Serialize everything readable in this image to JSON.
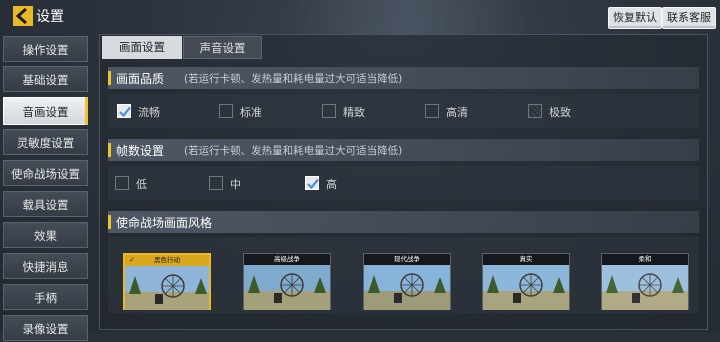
{
  "header": {
    "title": "设置",
    "reset_label": "恢复默认",
    "support_label": "联系客服"
  },
  "sidebar": {
    "items": [
      {
        "label": "操作设置"
      },
      {
        "label": "基础设置"
      },
      {
        "label": "音画设置",
        "active": true
      },
      {
        "label": "灵敏度设置"
      },
      {
        "label": "使命战场设置"
      },
      {
        "label": "载具设置"
      },
      {
        "label": "效果"
      },
      {
        "label": "快捷消息"
      },
      {
        "label": "手柄"
      },
      {
        "label": "录像设置"
      }
    ]
  },
  "tabs": [
    {
      "label": "画面设置",
      "active": true
    },
    {
      "label": "声音设置",
      "active": false
    }
  ],
  "quality": {
    "title": "画面品质",
    "note": "(若运行卡顿、发热量和耗电量过大可适当降低)",
    "options": [
      {
        "label": "流畅",
        "checked": true
      },
      {
        "label": "标准",
        "checked": false
      },
      {
        "label": "精致",
        "checked": false
      },
      {
        "label": "高清",
        "checked": false
      },
      {
        "label": "极致",
        "checked": false,
        "disabled": true
      }
    ]
  },
  "framerate": {
    "title": "帧数设置",
    "note": "(若运行卡顿、发热量和耗电量过大可适当降低)",
    "options": [
      {
        "label": "低",
        "checked": false
      },
      {
        "label": "中",
        "checked": false
      },
      {
        "label": "高",
        "checked": true
      }
    ]
  },
  "style": {
    "title": "使命战场画面风格",
    "options": [
      {
        "label": "黑色行动",
        "selected": true
      },
      {
        "label": "高级战争",
        "selected": false
      },
      {
        "label": "现代战争",
        "selected": false
      },
      {
        "label": "真实",
        "selected": false
      },
      {
        "label": "柔和",
        "selected": false
      }
    ]
  },
  "colors": {
    "accent": "#f2c12e",
    "selected_border": "#e9b92a"
  }
}
